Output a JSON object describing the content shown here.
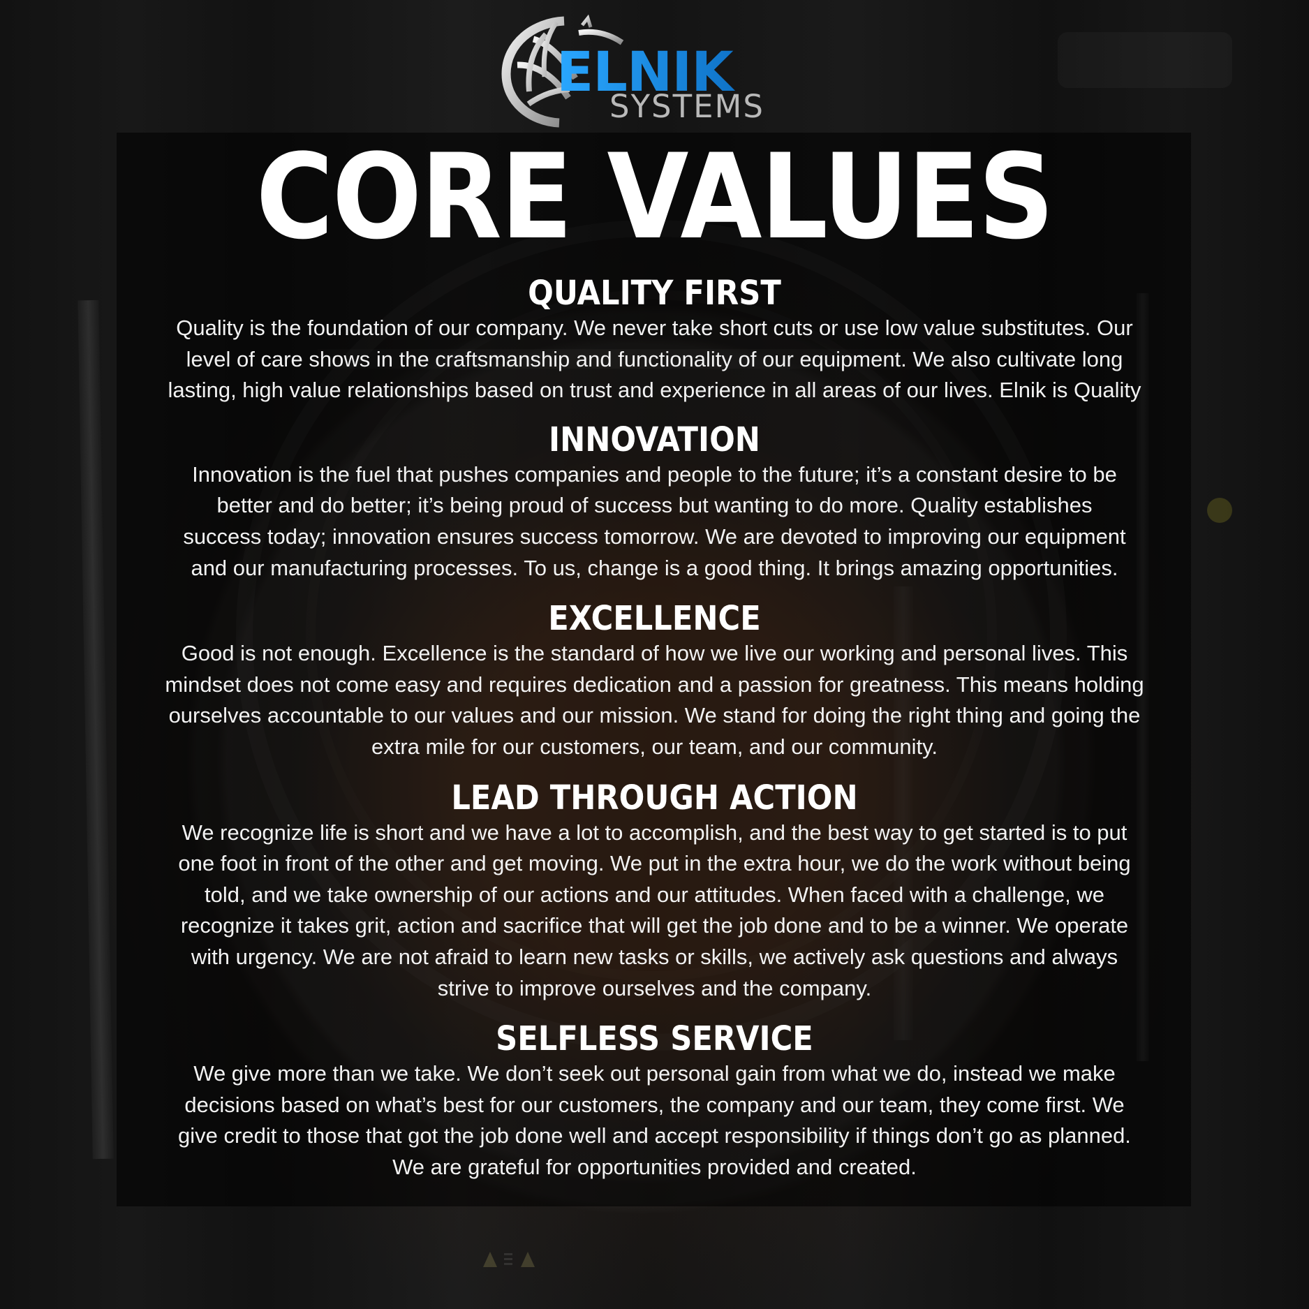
{
  "logo": {
    "primary_text": "ELNIK",
    "secondary_text": "SYSTEMS",
    "accent_color": "#1f8fe0",
    "text_color": "#b8b8b8"
  },
  "page": {
    "title": "CORE VALUES"
  },
  "sections": [
    {
      "title": "QUALITY FIRST",
      "body": "Quality is the foundation of our company. We never take short cuts or use low value substitutes. Our\nlevel of care shows in the craftsmanship and functionality of our equipment. We also cultivate long\nlasting, high value relationships based on trust and experience in all areas of our lives. Elnik is Quality"
    },
    {
      "title": "INNOVATION",
      "body": "Innovation is the fuel that pushes companies and people to the future; it’s a constant desire to be\nbetter and do better; it’s being proud of success but wanting to do more.   Quality establishes\nsuccess today; innovation ensures success tomorrow. We are devoted to improving our equipment\nand our manufacturing processes. To us, change is a good thing. It brings amazing opportunities."
    },
    {
      "title": "EXCELLENCE",
      "body": "Good is not enough. Excellence is the standard of how we live our working and personal lives. This\nmindset does not come easy and requires dedication and a passion for greatness. This means holding\nourselves accountable to our values and our mission. We stand for doing the right thing and going the\nextra mile for our customers, our team, and our community."
    },
    {
      "title": "LEAD THROUGH ACTION",
      "body": "We recognize life is short and we have a lot to accomplish, and the best way to get started is to put\none foot in front of the other and get moving. We put in the extra hour, we do the work without being\ntold, and we take ownership of our actions and our attitudes. When faced with a challenge, we\nrecognize it takes grit, action and sacrifice that will get the job done and to be a winner. We operate\nwith urgency. We are not afraid to learn new tasks or skills, we actively ask questions and always\nstrive to improve ourselves and the company."
    },
    {
      "title": "SELFLESS SERVICE",
      "body": "We give more than we take. We don’t seek out personal gain from what we do, instead we make\ndecisions based on what’s best for our customers, the company and our team, they come first.  We\ngive credit to those that got the job done well and accept responsibility if things don’t go as planned.\nWe are grateful for opportunities provided and created."
    }
  ]
}
